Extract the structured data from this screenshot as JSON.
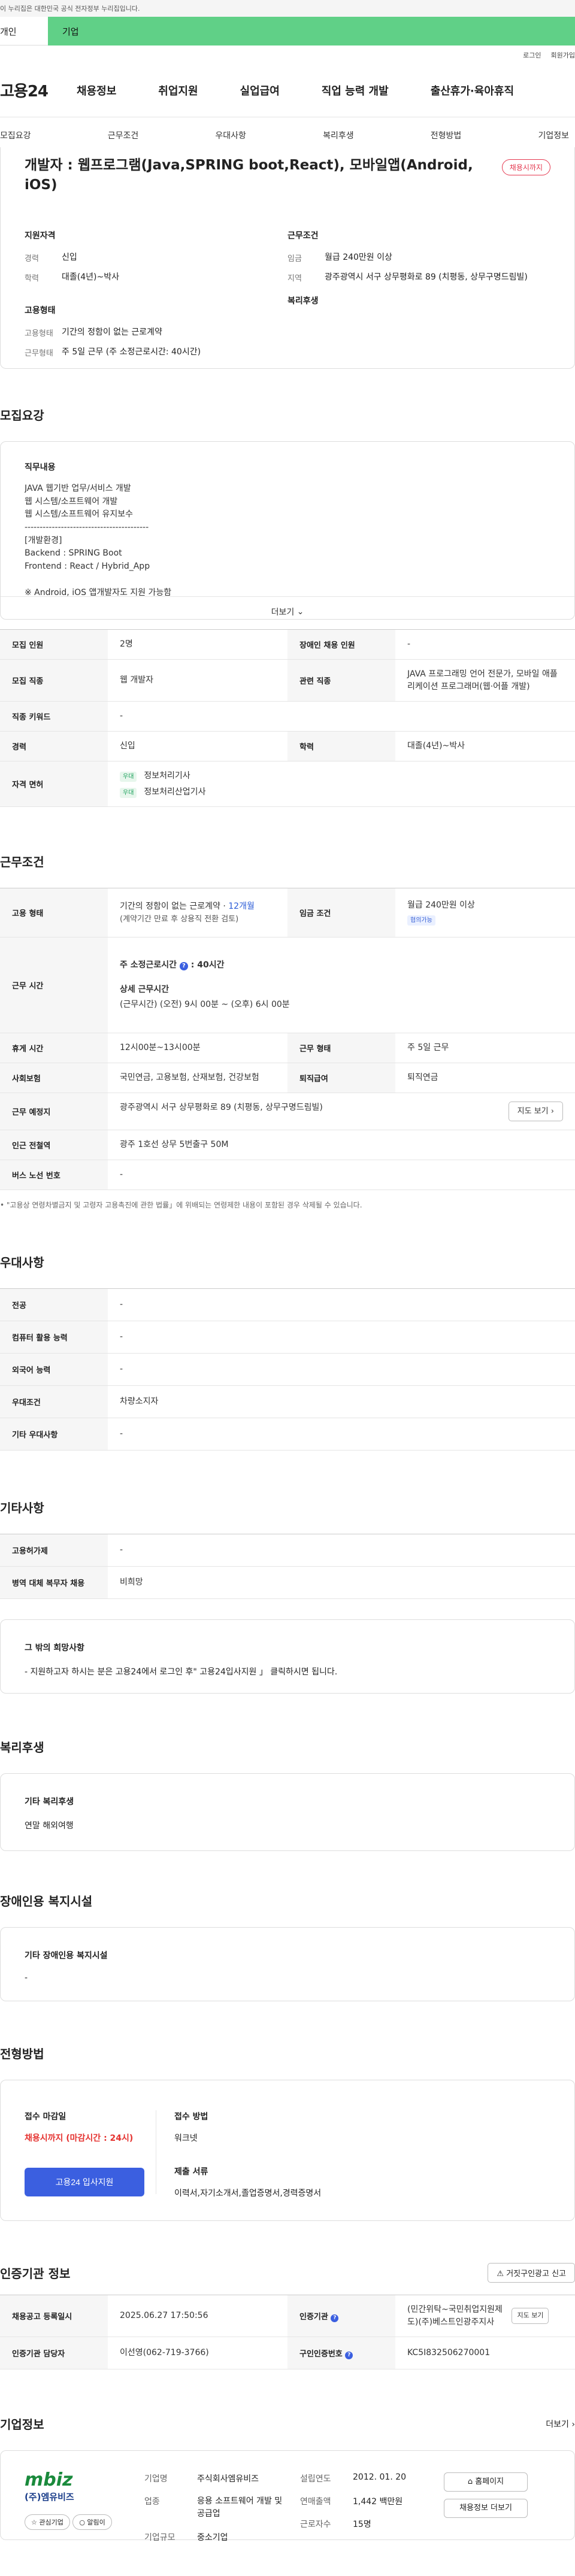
{
  "gov_notice": "이 누리집은 대한민국 공식 전자정부 누리집입니다.",
  "type_tabs": [
    "개인",
    "기업"
  ],
  "util_links": [
    "로그인",
    "회원가입"
  ],
  "gnb": {
    "logo": "고용24",
    "items": [
      "채용정보",
      "취업지원",
      "실업급여",
      "직업 능력 개발",
      "출산휴가·육아휴직"
    ]
  },
  "subnav": [
    "모집요강",
    "근무조건",
    "우대사항",
    "복리후생",
    "전형방법",
    "기업정보"
  ],
  "job": {
    "title": "개발자 : 웹프로그램(Java,SPRING boot,React), 모바일앱(Android, iOS)",
    "status_badge": "채용시까지",
    "qual_title": "지원자격",
    "cond_title": "근무조건",
    "type_title": "고용형태",
    "welfare_title": "복리후생",
    "qual": [
      {
        "k": "경력",
        "v": "신입"
      },
      {
        "k": "학력",
        "v": "대졸(4년)~박사"
      }
    ],
    "cond": [
      {
        "k": "임금",
        "v": "월급 240만원 이상"
      },
      {
        "k": "지역",
        "v": "광주광역시 서구 상무평화로 89 (치평동, 상무구명드림빌)"
      }
    ],
    "type": [
      {
        "k": "고용형태",
        "v": "기간의 정함이 없는 근로계약"
      },
      {
        "k": "근무형태",
        "v": "주 5일 근무 (주 소정근로시간: 40시간)"
      }
    ]
  },
  "recruit": {
    "section": "모집요강",
    "duty_title": "직무내용",
    "duty_text": "JAVA 웹기반 업무/서비스 개발\n웹 시스템/소프트웨어 개발\n웹 시스템/소프트웨어 유지보수\n-----------------------------------------\n[개발환경]\nBackend : SPRING Boot\nFrontend : React / Hybrid_App\n\n※ Android, iOS 앱개발자도 지원 가능함",
    "more": "더보기",
    "rows": {
      "headcount_k": "모집 인원",
      "headcount_v": "2명",
      "disabled_k": "장애인 채용 인원",
      "disabled_v": "-",
      "job_k": "모집 직종",
      "job_v": "웹 개발자",
      "rel_k": "관련 직종",
      "rel_v": "JAVA 프로그래밍 언어 전문가, 모바일 애플리케이션 프로그래머(웹·어플 개발)",
      "kw_k": "직종 키워드",
      "kw_v": "-",
      "career_k": "경력",
      "career_v": "신입",
      "edu_k": "학력",
      "edu_v": "대졸(4년)~박사",
      "cert_k": "자격 면허",
      "certs": [
        {
          "tag": "우대",
          "name": "정보처리기사"
        },
        {
          "tag": "우대",
          "name": "정보처리산업기사"
        }
      ]
    }
  },
  "work": {
    "section": "근무조건",
    "emp_k": "고용 형태",
    "emp_v": "기간의 정함이 없는 근로계약 ·",
    "emp_probation": "12개월",
    "emp_note": "(계약기간 만료 후 상용직 전환 검토)",
    "wage_k": "임금 조건",
    "wage_v": "월급 240만원 이상",
    "wage_tag": "협의가능",
    "hours_k": "근무 시간",
    "hours_weekly": "주 소정근로시간",
    "hours_weekly_v": "40시간",
    "hours_detail_title": "상세 근무시간",
    "hours_detail": "(근무시간) (오전) 9시 00분 ~ (오후) 6시 00분",
    "break_k": "휴게 시간",
    "break_v": "12시00분~13시00분",
    "shift_k": "근무 형태",
    "shift_v": "주 5일 근무",
    "ins_k": "사회보험",
    "ins_v": "국민연금, 고용보험, 산재보험, 건강보험",
    "sev_k": "퇴직급여",
    "sev_v": "퇴직연금",
    "loc_k": "근무 예정지",
    "loc_v": "광주광역시 서구 상무평화로 89 (치평동, 상무구명드림빌)",
    "map_btn": "지도 보기",
    "subway_k": "인근 전철역",
    "subway_v": "광주 1호선 상무 5번출구 50M",
    "bus_k": "버스 노선 번호",
    "bus_v": "-",
    "note": "\"고용상 연령차별금지 및 고령자 고용촉진에 관한 법률」에 위배되는 연령제한 내용이 포함된 경우 삭제될 수 있습니다."
  },
  "pref": {
    "section": "우대사항",
    "rows": [
      {
        "k": "전공",
        "v": "-"
      },
      {
        "k": "컴퓨터 활용 능력",
        "v": "-"
      },
      {
        "k": "외국어 능력",
        "v": "-"
      },
      {
        "k": "우대조건",
        "v": "차량소지자"
      },
      {
        "k": "기타 우대사항",
        "v": "-"
      }
    ]
  },
  "etc": {
    "section": "기타사항",
    "rows": [
      {
        "k": "고용허가제",
        "v": "-"
      },
      {
        "k": "병역 대체 복무자 채용",
        "v": "비희망"
      }
    ],
    "other_title": "그 밖의 희망사항",
    "other_text": "- 지원하고자 하시는 분은 고용24에서 로그인 후\" 고용24입사지원 」 클릭하시면 됩니다."
  },
  "welfare": {
    "section": "복리후생",
    "title": "기타 복리후생",
    "text": "연말 해외여행"
  },
  "disab": {
    "section": "장애인용 복지시설",
    "title": "기타 장애인용 복지시설",
    "text": "-"
  },
  "screen": {
    "section": "전형방법",
    "deadline_title": "접수 마감일",
    "deadline_v": "채용시까지 (마감시간 : 24시)",
    "method_title": "접수 방법",
    "method_v": "워크넷",
    "docs_title": "제출 서류",
    "docs_v": "이력서,자기소개서,졸업증명서,경력증명서",
    "apply_btn": "고용24 입사지원"
  },
  "cert": {
    "section": "인증기관 정보",
    "report_btn": "거짓구인광고 신고",
    "reg_k": "채용공고 등록일시",
    "reg_v": "2025.06.27 17:50:56",
    "org_k": "인증기관",
    "org_v": "(민간위탁~국민취업지원제도)(주)베스트인광주지사",
    "org_btn": "지도 보기",
    "mgr_k": "인증기관 담당자",
    "mgr_v": "이선영(062-719-3766)",
    "no_k": "구인인증번호",
    "no_v": "KC5I832506270001"
  },
  "company": {
    "section": "기업정보",
    "more": "더보기",
    "logo_text": "mbiz",
    "logo_sub": "(주)엠유비즈",
    "fav_btn": "관심기업",
    "follow_btn": "알림이",
    "name_k": "기업명",
    "name_v": "주식회사엠유비즈",
    "industry_k": "업종",
    "industry_v": "응용 소프트웨어 개발 및 공급업",
    "size_k": "기업규모",
    "size_v": "중소기업",
    "est_k": "설립연도",
    "est_v": "2012. 01. 20",
    "sales_k": "연매출액",
    "sales_v": "1,442 백만원",
    "emp_k": "근로자수",
    "emp_v": "15명",
    "home_btn": "홈페이지",
    "list_btn": "채용정보 더보기"
  },
  "colors": {
    "accent": "#3b5fe0",
    "green": "#60d087",
    "red": "#e5322f"
  }
}
